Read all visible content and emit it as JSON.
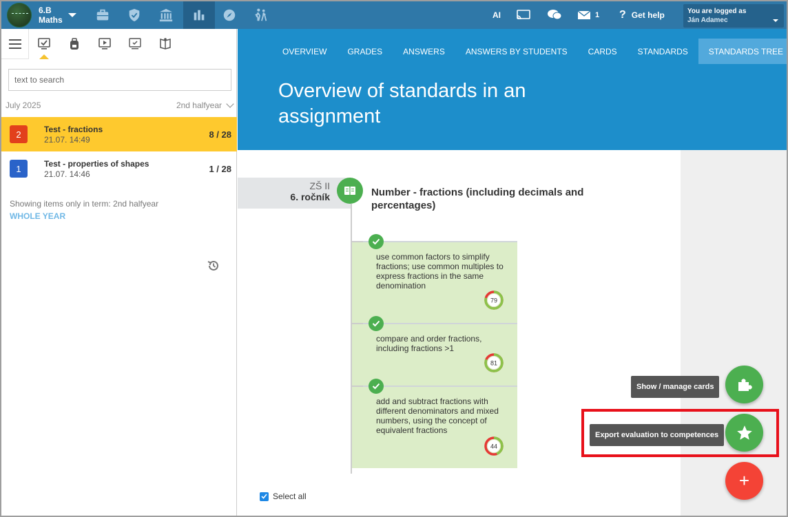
{
  "topbar": {
    "class_name_line1": "6.B",
    "class_name_line2": "Maths",
    "tools": [
      "briefcase-icon",
      "shield-check-icon",
      "bank-icon",
      "bar-chart-icon",
      "compass-icon",
      "people-walking-icon"
    ],
    "ai_label": "AI",
    "messages_count": "1",
    "help_label": "Get help",
    "logged_in_label": "You are logged as",
    "user_name": "Ján Adamec"
  },
  "left": {
    "tabs": [
      "menu-icon",
      "checklist-monitor-icon",
      "backpack-icon",
      "play-screen-icon",
      "checkbox-monitor-icon",
      "open-book-icon"
    ],
    "search_placeholder": "text to search",
    "term_label": "July 2025",
    "halfyear_label": "2nd halfyear",
    "assignments": [
      {
        "num": "2",
        "title": "Test - fractions",
        "date": "21.07. 14:49",
        "score": "8 / 28",
        "color": "#e2401c"
      },
      {
        "num": "1",
        "title": "Test - properties of shapes",
        "date": "21.07. 14:46",
        "score": "1 / 28",
        "color": "#2a63c9"
      }
    ],
    "showing_text": "Showing items only in term: 2nd halfyear",
    "whole_year_label": "WHOLE YEAR"
  },
  "content": {
    "nav": [
      "OVERVIEW",
      "GRADES",
      "ANSWERS",
      "ANSWERS BY STUDENTS",
      "CARDS",
      "STANDARDS",
      "STANDARDS TREE"
    ],
    "active_nav": 6,
    "title": "Overview of standards in an assignment",
    "level_line1": "ZŠ II",
    "level_line2": "6. ročník",
    "standard_title": "Number - fractions (including decimals and percentages)",
    "standards": [
      {
        "text": "use common factors to simplify fractions; use common multiples to express fractions in the same denomination",
        "value": 79
      },
      {
        "text": "compare and order fractions, including fractions >1",
        "value": 81
      },
      {
        "text": "add and subtract fractions with different denominators and mixed numbers, using the concept of equivalent fractions",
        "value": 44
      }
    ],
    "select_all_label": "Select all"
  },
  "fabs": {
    "cards_tooltip": "Show / manage cards",
    "export_tooltip": "Export evaluation to competences",
    "add_label": "+"
  },
  "colors": {
    "topbar": "#2f78a8",
    "header": "#1d8ecb",
    "selected_item": "#fec92e",
    "green": "#4caf50",
    "red_fab": "#f44336"
  }
}
